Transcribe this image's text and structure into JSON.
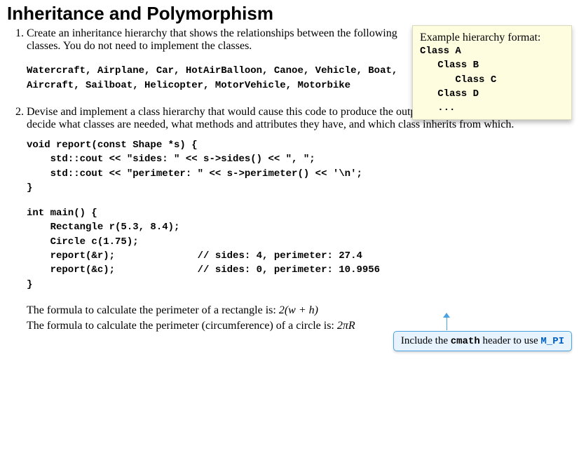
{
  "heading": "Inheritance and Polymorphism",
  "sidenote": {
    "intro": "Example hierarchy format:",
    "lines": [
      "Class A",
      "   Class B",
      "      Class C",
      "   Class D",
      "   ..."
    ]
  },
  "q1": {
    "prompt": "Create an inheritance hierarchy that shows the relationships between the following classes. You do not need to implement the classes.",
    "classes": "Watercraft, Airplane, Car, HotAirBalloon, Canoe, Vehicle, Boat, Aircraft, Sailboat, Helicopter, MotorVehicle, Motorbike"
  },
  "q2": {
    "prompt": "Devise and implement a class hierarchy that would cause this code to produce the outputs indicated. You will need to decide what classes are needed, what methods and attributes they have, and which class inherits from which.",
    "code1": "void report(const Shape *s) {\n    std::cout << \"sides: \" << s->sides() << \", \";\n    std::cout << \"perimeter: \" << s->perimeter() << '\\n';\n}",
    "code2": "int main() {\n    Rectangle r(5.3, 8.4);\n    Circle c(1.75);\n    report(&r);              // sides: 4, perimeter: 27.4\n    report(&c);              // sides: 0, perimeter: 10.9956\n}",
    "formula_rect_pre": "The formula to calculate the perimeter of a rectangle is: ",
    "formula_rect_math": "2(w + h)",
    "formula_circ_pre": "The formula to calculate the perimeter (circumference) of a circle is: ",
    "formula_circ_math": "2πR"
  },
  "callout": {
    "pre": "Include the ",
    "code1": "cmath",
    "mid": " header to use ",
    "code2": "M_PI"
  }
}
